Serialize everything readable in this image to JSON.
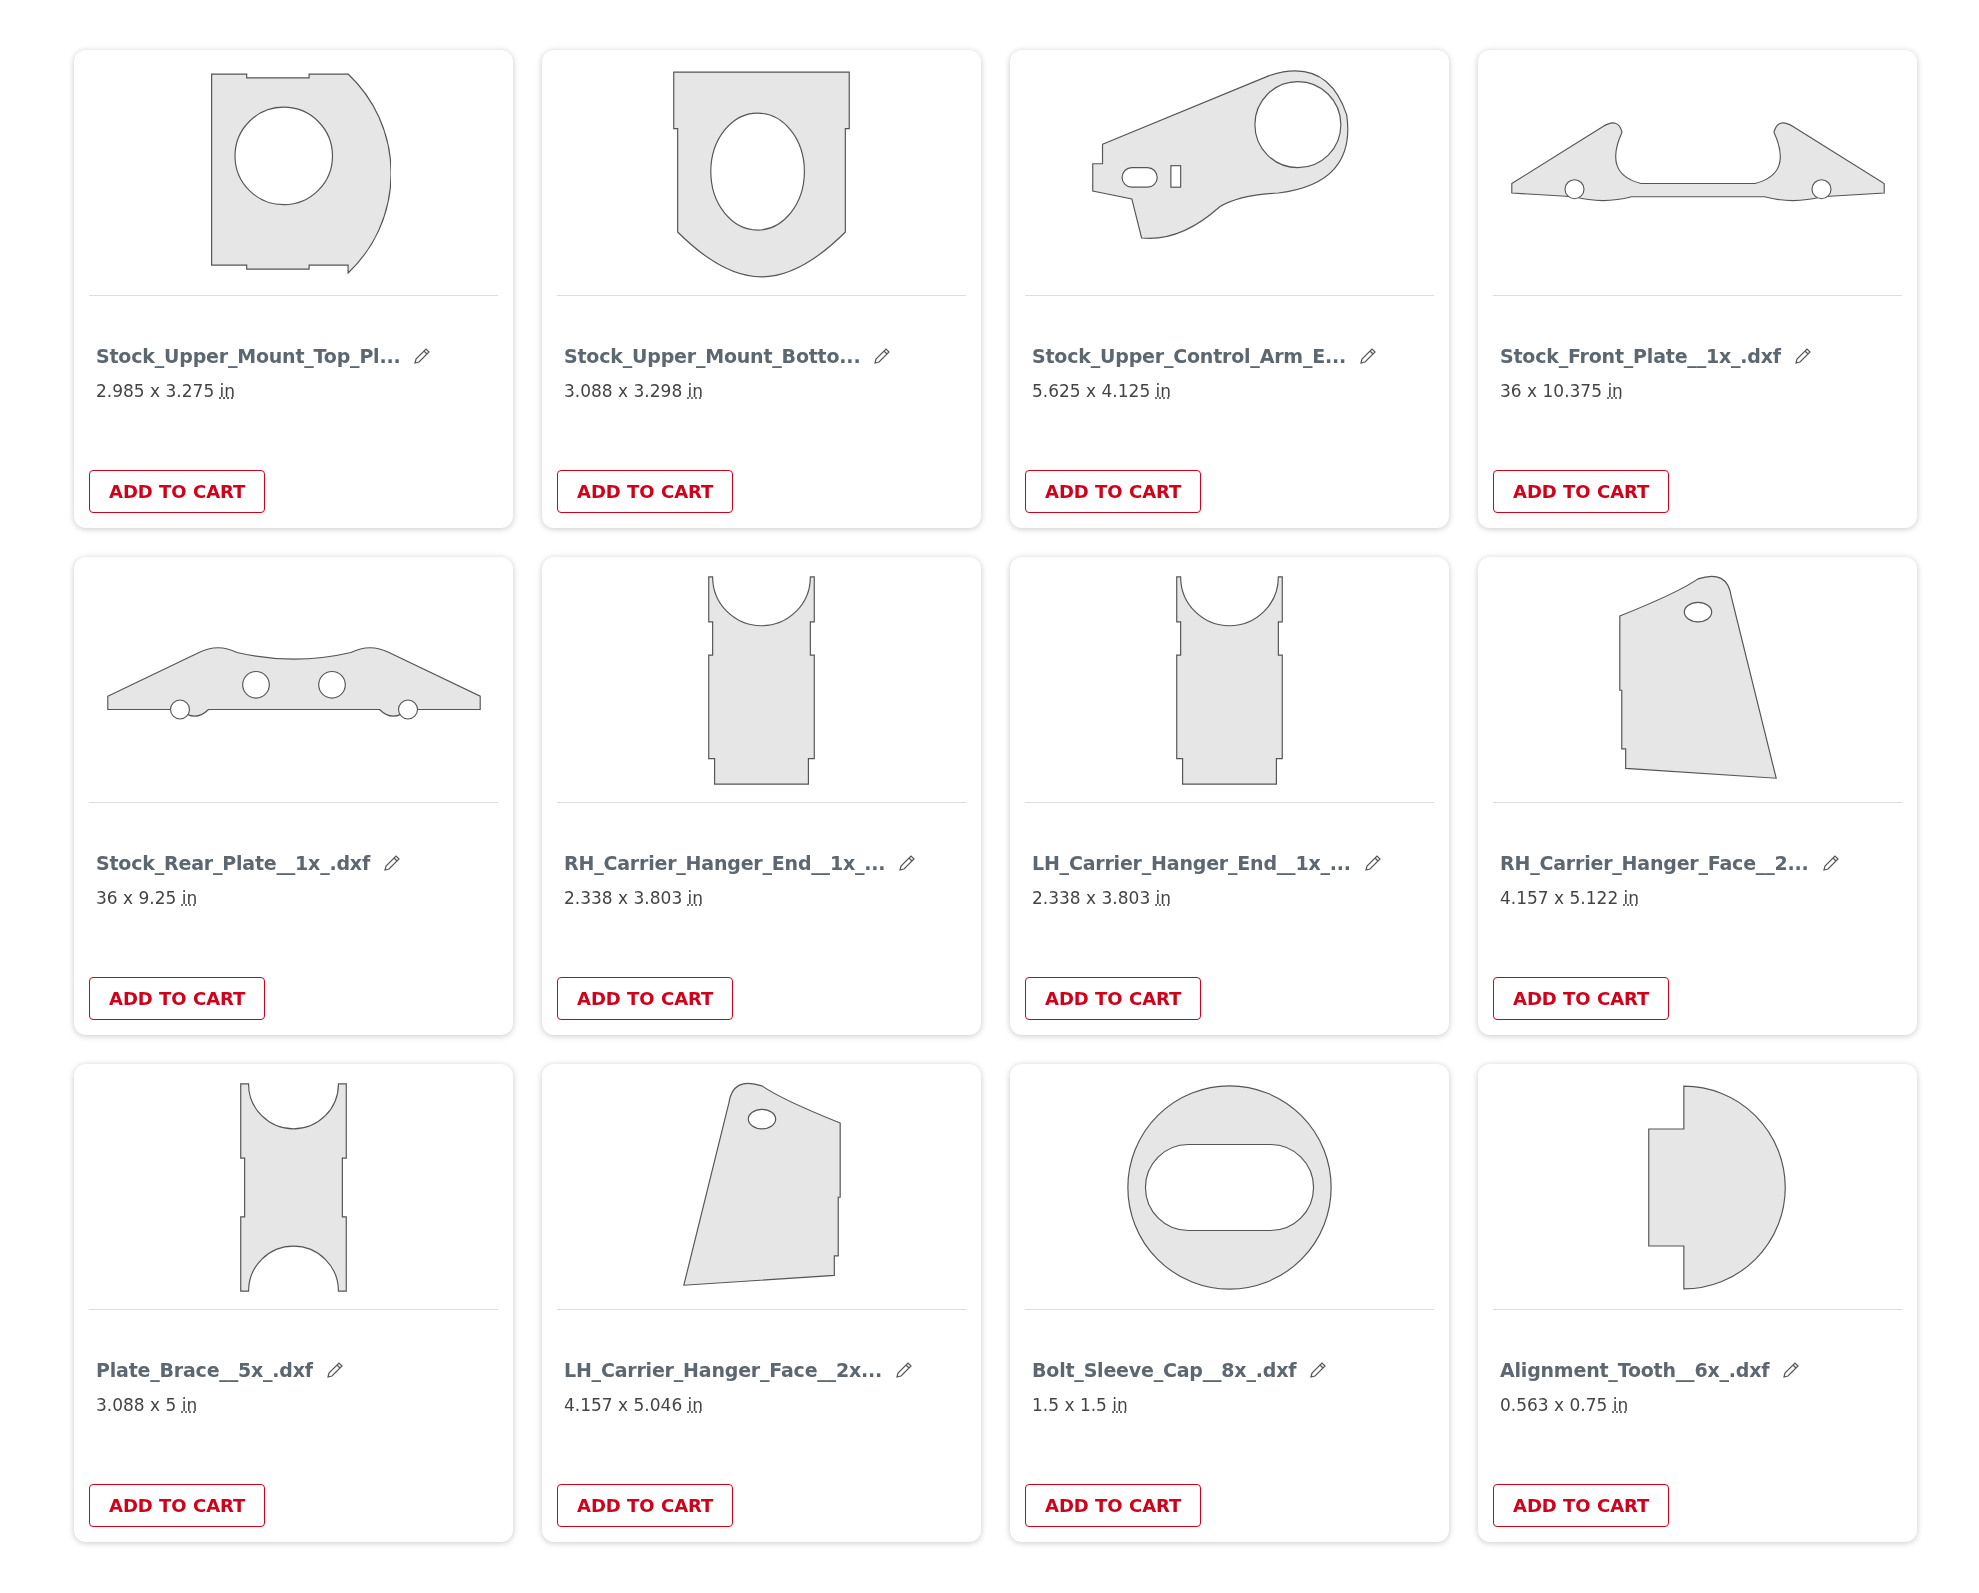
{
  "products": [
    {
      "title": "Stock_Upper_Mount_Top_Pl...",
      "dimensions": "2.985 x 3.275",
      "unit": "in",
      "button": "ADD TO CART"
    },
    {
      "title": "Stock_Upper_Mount_Botto...",
      "dimensions": "3.088 x 3.298",
      "unit": "in",
      "button": "ADD TO CART"
    },
    {
      "title": "Stock_Upper_Control_Arm_E...",
      "dimensions": "5.625 x 4.125",
      "unit": "in",
      "button": "ADD TO CART"
    },
    {
      "title": "Stock_Front_Plate__1x_.dxf",
      "dimensions": "36 x 10.375",
      "unit": "in",
      "button": "ADD TO CART"
    },
    {
      "title": "Stock_Rear_Plate__1x_.dxf",
      "dimensions": "36 x 9.25",
      "unit": "in",
      "button": "ADD TO CART"
    },
    {
      "title": "RH_Carrier_Hanger_End__1x_...",
      "dimensions": "2.338 x 3.803",
      "unit": "in",
      "button": "ADD TO CART"
    },
    {
      "title": "LH_Carrier_Hanger_End__1x_...",
      "dimensions": "2.338 x 3.803",
      "unit": "in",
      "button": "ADD TO CART"
    },
    {
      "title": "RH_Carrier_Hanger_Face__2...",
      "dimensions": "4.157 x 5.122",
      "unit": "in",
      "button": "ADD TO CART"
    },
    {
      "title": "Plate_Brace__5x_.dxf",
      "dimensions": "3.088 x 5",
      "unit": "in",
      "button": "ADD TO CART"
    },
    {
      "title": "LH_Carrier_Hanger_Face__2x...",
      "dimensions": "4.157 x 5.046",
      "unit": "in",
      "button": "ADD TO CART"
    },
    {
      "title": "Bolt_Sleeve_Cap__8x_.dxf",
      "dimensions": "1.5 x 1.5",
      "unit": "in",
      "button": "ADD TO CART"
    },
    {
      "title": "Alignment_Tooth__6x_.dxf",
      "dimensions": "0.563 x 0.75",
      "unit": "in",
      "button": "ADD TO CART"
    }
  ]
}
